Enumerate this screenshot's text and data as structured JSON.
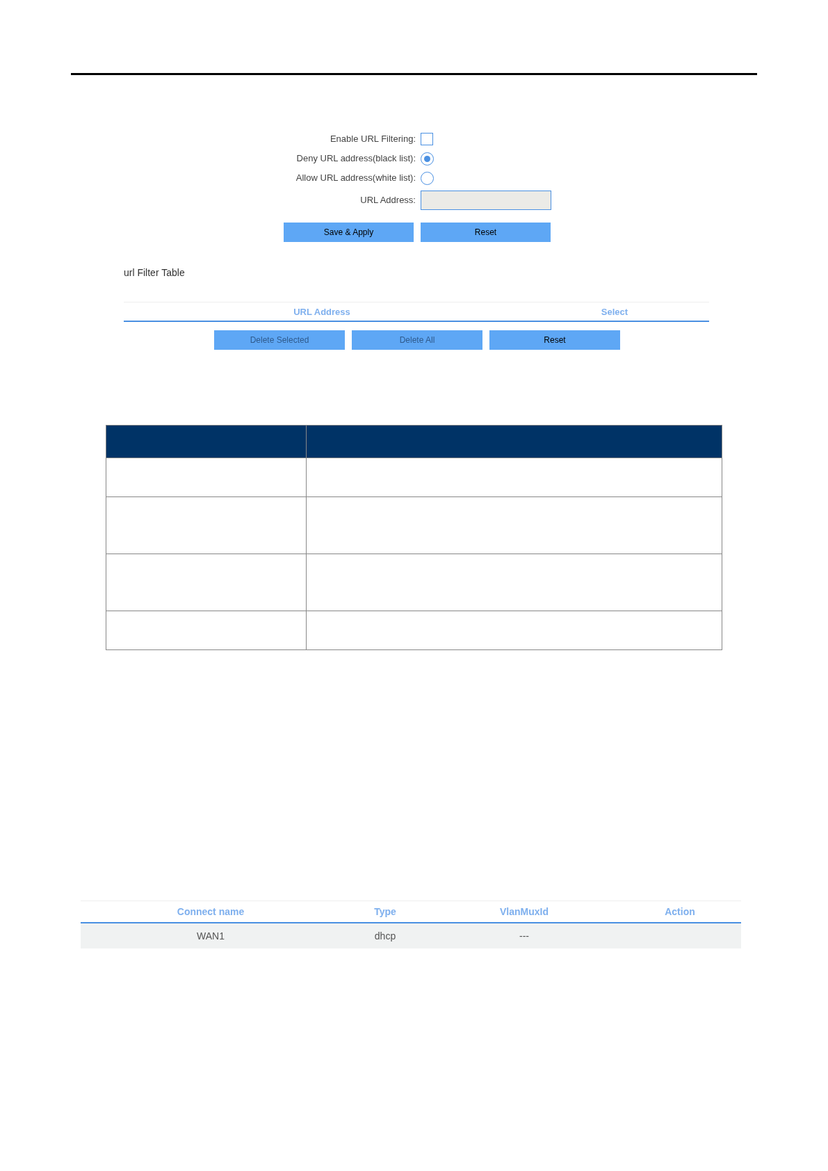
{
  "url_filter_form": {
    "fields": [
      {
        "kind": "checkbox",
        "label": "Enable URL Filtering:",
        "checked": false
      },
      {
        "kind": "radio",
        "label": "Deny URL address(black list):",
        "selected": true
      },
      {
        "kind": "radio",
        "label": "Allow URL address(white list):",
        "selected": false
      },
      {
        "kind": "text",
        "label": "URL Address:"
      }
    ],
    "buttons": [
      {
        "label": "Save & Apply",
        "disabled": false
      },
      {
        "label": "Reset",
        "disabled": false
      }
    ]
  },
  "url_filter_table": {
    "title": "url Filter Table",
    "columns": [
      "URL Address",
      "Select"
    ],
    "buttons": [
      {
        "label": "Delete Selected",
        "disabled": true
      },
      {
        "label": "Delete All",
        "disabled": true
      },
      {
        "label": "Reset",
        "disabled": false
      }
    ]
  },
  "wan_table": {
    "columns": [
      "Connect name",
      "Type",
      "VlanMuxId",
      "Action"
    ],
    "rows": [
      [
        "WAN1",
        "dhcp",
        "---"
      ]
    ]
  }
}
